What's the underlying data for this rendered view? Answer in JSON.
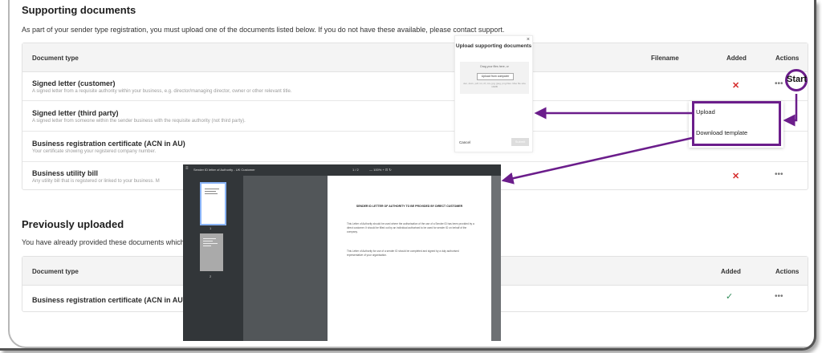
{
  "supporting": {
    "heading": "Supporting documents",
    "intro": "As part of your sender type registration, you must upload one of the documents listed below. If you do not have these available, please contact support.",
    "columns": {
      "doc_type": "Document type",
      "filename": "Filename",
      "added": "Added",
      "actions": "Actions"
    },
    "rows": [
      {
        "title": "Signed letter (customer)",
        "desc": "A signed letter from a requisite authority within your business, e.g. director/managing director, owner or other relevant title.",
        "added": "✕",
        "actions": "•••",
        "start_label": "Start"
      },
      {
        "title": "Signed letter (third party)",
        "desc": "A signed letter from someone within the sender business with the requisite authority (not third party).",
        "added": "",
        "actions": ""
      },
      {
        "title": "Business registration certificate (ACN in AU)",
        "desc": "Your certificate showing your registered company number.",
        "added": "",
        "actions": ""
      },
      {
        "title": "Business utility bill",
        "desc": "Any utility bill that is registered or linked to your business. M",
        "added": "✕",
        "actions": "•••"
      }
    ]
  },
  "previously": {
    "heading": "Previously uploaded",
    "intro": "You have already provided these documents which y",
    "columns": {
      "doc_type": "Document type",
      "added": "Added",
      "actions": "Actions"
    },
    "rows": [
      {
        "title": "Business registration certificate (ACN in AU)",
        "added": "✓",
        "actions": "•••"
      }
    ]
  },
  "upload_modal": {
    "title": "Upload supporting documents",
    "close": "×",
    "drag_text": "Drag your files here, or",
    "browse_button": "Upload from computer",
    "hint": "doc, docx, pdf, txt, rtf, csv, jpg, jpeg, png files. Max file size 10MB",
    "cancel": "Cancel",
    "submit": "Submit"
  },
  "action_menu": {
    "upload": "Upload",
    "download_template": "Download template"
  },
  "pdf_viewer": {
    "menu_icon": "≡",
    "file_title": "Sender ID letter of Authority - UK Customer",
    "page_indicator": "1 / 2",
    "zoom_controls": "—  100%  +    ⊡  ↻",
    "thumb_1": "1",
    "thumb_2": "2",
    "doc_title": "SENDER ID LETTER OF AUTHORITY TO BE PROVIDED BY DIRECT CUSTOMER",
    "doc_para_1": "This Letter of Authority should be used where the authorisation of the use of a Sender ID has been provided by a direct customer. It should be filled out by an individual authorised to be used for sender ID on behalf of the company.",
    "doc_para_2": "This Letter of Authority for use of a sender ID should be completed and signed by a duly authorised representative of your organisation."
  },
  "colors": {
    "highlight": "#6b1d8b",
    "error": "#d52b2b",
    "success": "#2e8b57"
  }
}
